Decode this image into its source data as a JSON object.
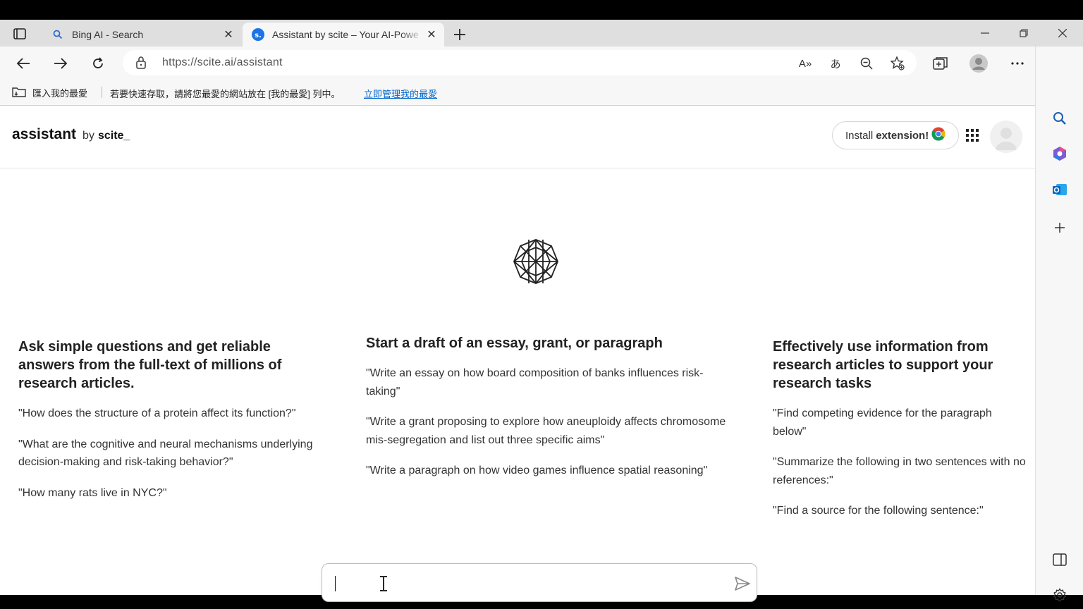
{
  "browser": {
    "tabs": [
      {
        "title": "Bing AI - Search",
        "icon": "search-icon",
        "active": false
      },
      {
        "title": "Assistant by scite – Your AI-Powe",
        "icon": "scite-favicon",
        "active": true
      }
    ],
    "url": "https://scite.ai/assistant",
    "favorites_bar": {
      "import_label": "匯入我的最愛",
      "hint": "若要快速存取，請將您最愛的網站放在 [我的最愛] 列中。",
      "manage_link": "立即管理我的最愛"
    },
    "read_aloud_label": "A»",
    "translate_label": "あ"
  },
  "app": {
    "brand_main": "assistant",
    "brand_by": "by",
    "brand_company": "scite_",
    "install_prefix": "Install",
    "install_bold": "extension!"
  },
  "columns": [
    {
      "heading": "Ask simple questions and get reliable answers from the full-text of millions of research articles.",
      "examples": [
        "\"How does the structure of a protein affect its function?\"",
        "\"What are the cognitive and neural mechanisms underlying decision-making and risk-taking behavior?\"",
        "\"How many rats live in NYC?\""
      ]
    },
    {
      "heading": "Start a draft of an essay, grant, or paragraph",
      "examples": [
        "\"Write an essay on how board composition of banks influences risk-taking\"",
        "\"Write a grant proposing to explore how aneuploidy affects chromosome mis-segregation and list out three specific aims\"",
        "\"Write a paragraph on how video games influence spatial reasoning\""
      ]
    },
    {
      "heading": "Effectively use information from research articles to support your research tasks",
      "examples": [
        "\"Find competing evidence for the paragraph below\"",
        "\"Summarize the following in two sentences with no references:\"",
        "\"Find a source for the following sentence:\""
      ]
    }
  ],
  "chat_input": {
    "value": ""
  },
  "colors": {
    "link": "#0066cc",
    "bing": "#1a73e8"
  }
}
